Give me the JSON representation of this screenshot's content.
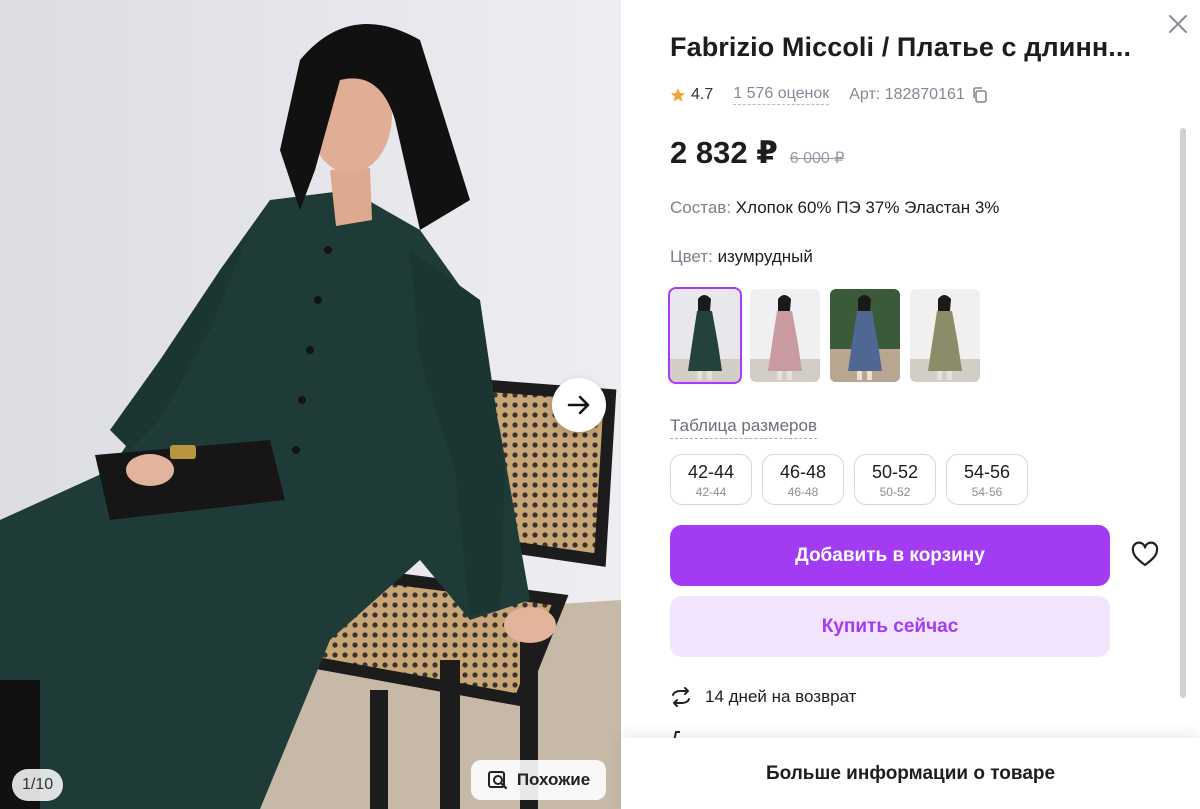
{
  "gallery": {
    "counter": "1/10",
    "similar_label": "Похожие",
    "next_icon": "arrow-right-icon"
  },
  "product": {
    "title": "Fabrizio Miccoli / Платье с длинн...",
    "rating": "4.7",
    "reviews": "1 576 оценок",
    "article": "Арт: 182870161",
    "price": "2 832 ₽",
    "old_price": "6 000 ₽",
    "composition_label": "Состав:",
    "composition_value": "Хлопок 60% ПЭ 37% Эластан 3%",
    "color_label": "Цвет:",
    "color_value": "изумрудный",
    "colors": [
      {
        "name": "изумрудный",
        "hex": "#23423e",
        "selected": true
      },
      {
        "name": "розовый",
        "hex": "#c99aa0",
        "selected": false
      },
      {
        "name": "синий",
        "hex": "#4f6793",
        "selected": false
      },
      {
        "name": "оливковый",
        "hex": "#8c8c68",
        "selected": false
      }
    ],
    "size_table_label": "Таблица размеров",
    "sizes": [
      {
        "label": "42-44",
        "sub": "42-44"
      },
      {
        "label": "46-48",
        "sub": "46-48"
      },
      {
        "label": "50-52",
        "sub": "50-52"
      },
      {
        "label": "54-56",
        "sub": "54-56"
      }
    ],
    "add_to_cart": "Добавить в корзину",
    "buy_now": "Купить сейчас",
    "returns": "14 дней на возврат",
    "more_info": "Больше информации о товаре"
  },
  "colors": {
    "accent": "#a23bf2",
    "accent_light": "#f2e4fd",
    "star": "#f6a03c"
  }
}
